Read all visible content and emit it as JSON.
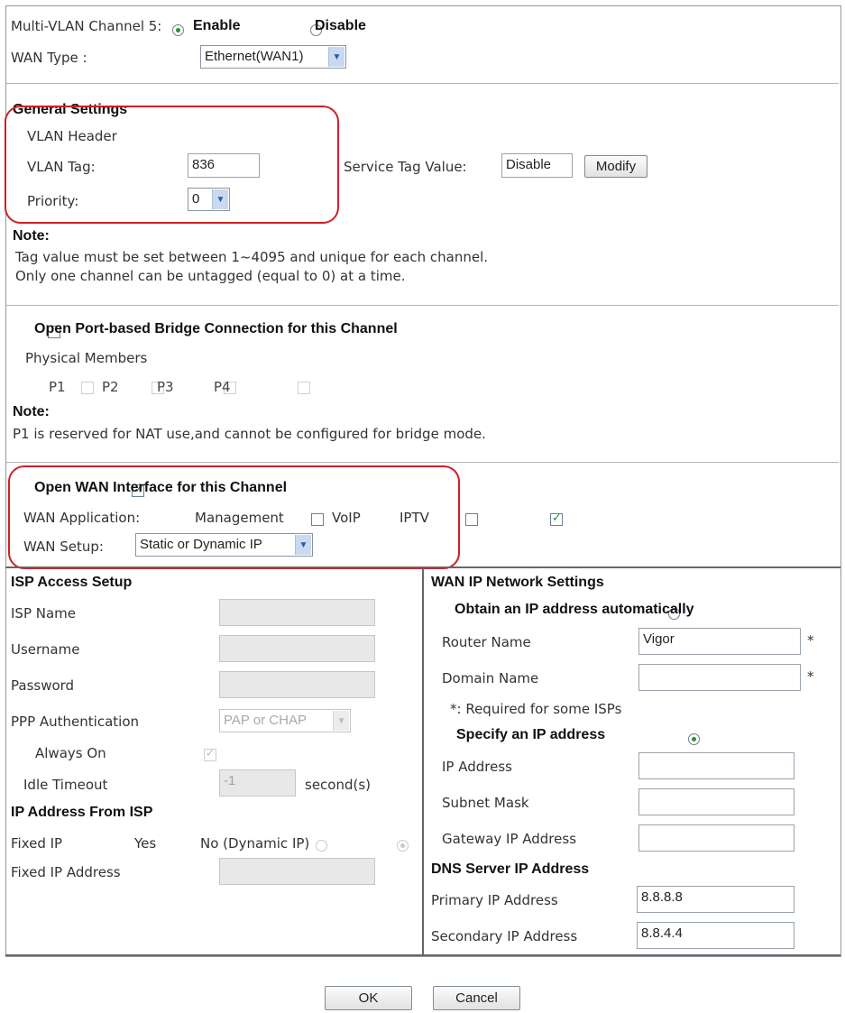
{
  "channel": {
    "label": "Multi-VLAN Channel 5:",
    "enable_label": "Enable",
    "disable_label": "Disable",
    "wan_type_label": "WAN Type :",
    "wan_type_value": "Ethernet(WAN1)"
  },
  "general": {
    "heading": "General Settings",
    "vlan_header": "VLAN Header",
    "vlan_tag_label": "VLAN Tag:",
    "vlan_tag_value": "836",
    "service_tag_label": "Service Tag Value:",
    "service_tag_value": "Disable",
    "modify_label": "Modify",
    "priority_label": "Priority:",
    "priority_value": "0",
    "note_title": "Note:",
    "note_line1": "Tag value must be set between 1~4095 and unique for each channel.",
    "note_line2": "Only one channel can be untagged (equal to 0) at a time."
  },
  "bridge": {
    "checkbox_label": "Open Port-based Bridge Connection for this Channel",
    "physical_members": "Physical Members",
    "ports": [
      "P1",
      "P2",
      "P3",
      "P4"
    ],
    "note_title": "Note:",
    "note_line": "P1 is reserved for NAT use,and cannot be configured for bridge mode."
  },
  "wan": {
    "checkbox_label": "Open WAN Interface for this Channel",
    "application_label": "WAN Application:",
    "app_management": "Management",
    "app_voip": "VoIP",
    "app_iptv": "IPTV",
    "setup_label": "WAN Setup:",
    "setup_value": "Static or Dynamic IP"
  },
  "isp": {
    "heading": "ISP Access Setup",
    "isp_name": "ISP Name",
    "username": "Username",
    "password": "Password",
    "ppp_auth": "PPP Authentication",
    "ppp_auth_value": "PAP or CHAP",
    "always_on": "Always On",
    "idle_timeout": "Idle Timeout",
    "idle_value": "-1",
    "idle_unit": "second(s)",
    "ip_from_isp": "IP Address From ISP",
    "fixed_ip": "Fixed IP",
    "yes": "Yes",
    "no": "No (Dynamic IP)",
    "fixed_ip_address": "Fixed IP Address"
  },
  "wanip": {
    "heading": "WAN IP Network Settings",
    "obtain": "Obtain an IP address automatically",
    "router_name": "Router Name",
    "router_name_value": "Vigor",
    "domain_name": "Domain Name",
    "asterisk": "*",
    "required_note": "*: Required for some ISPs",
    "specify": "Specify an IP address",
    "ip_address": "IP Address",
    "subnet_mask": "Subnet Mask",
    "gateway": "Gateway IP Address",
    "dns_heading": "DNS Server IP Address",
    "primary": "Primary IP Address",
    "primary_value": "8.8.8.8",
    "secondary": "Secondary IP Address",
    "secondary_value": "8.8.4.4"
  },
  "buttons": {
    "ok": "OK",
    "cancel": "Cancel"
  },
  "colors": {
    "highlight": "#d11f26",
    "checked": "#2f8f2f"
  }
}
